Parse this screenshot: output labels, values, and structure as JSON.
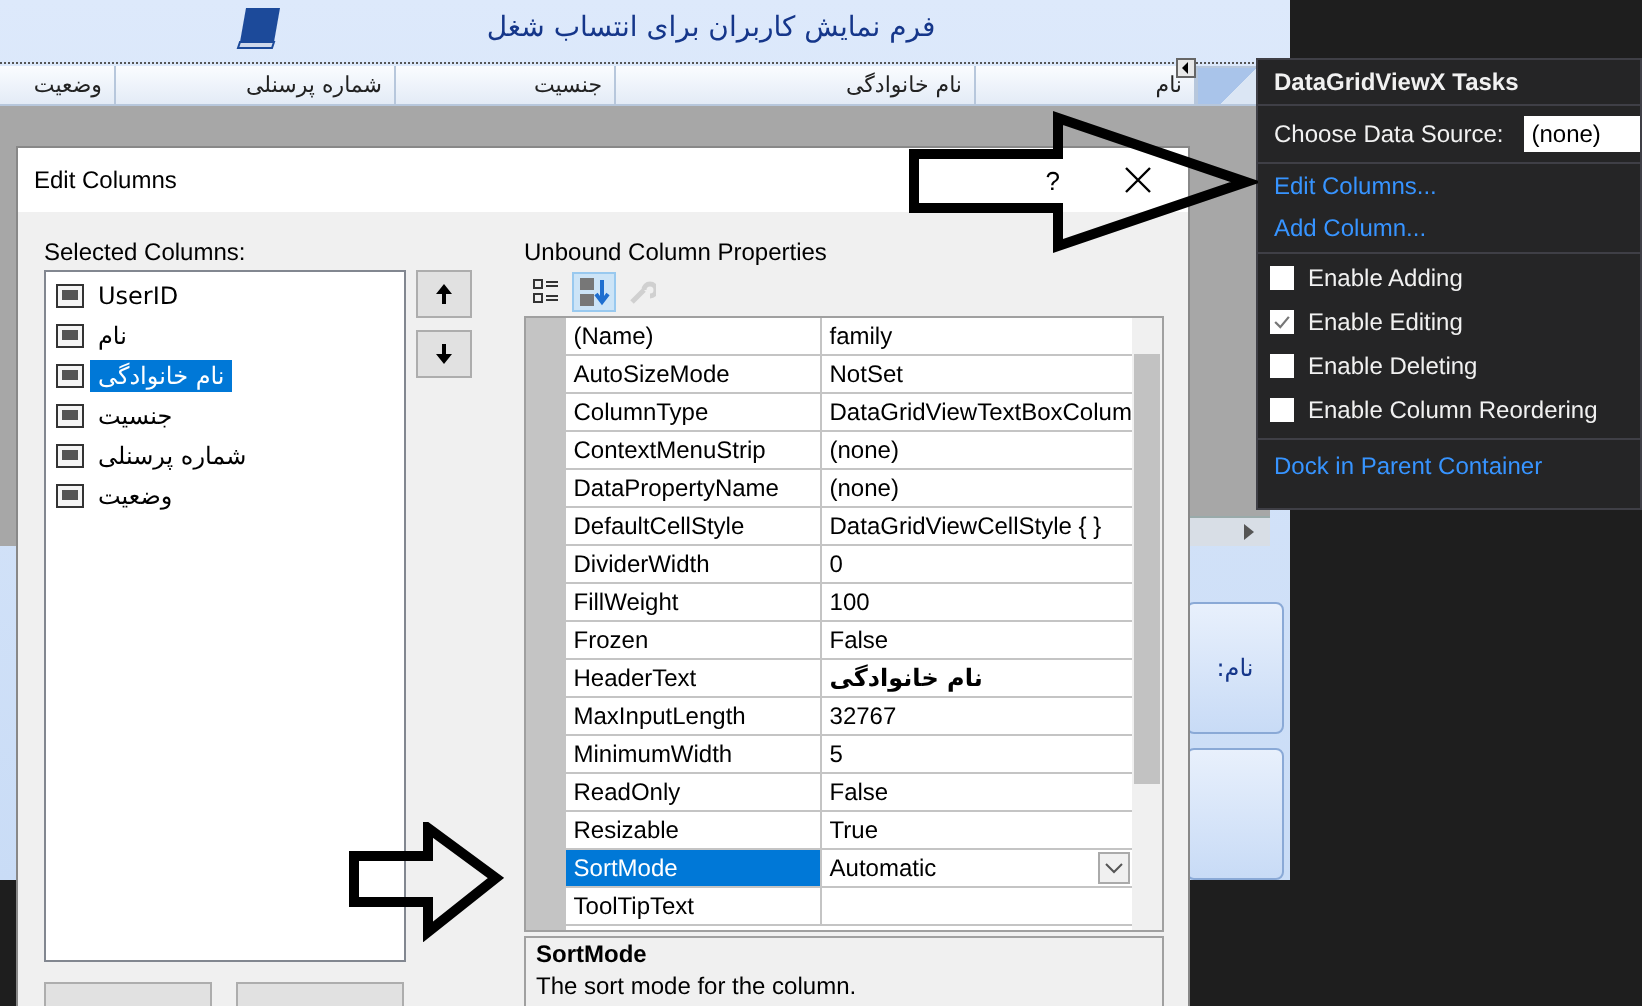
{
  "form": {
    "title": "فرم نمایش کاربران برای انتساب شغل",
    "grid_columns": [
      "نام",
      "نام خانوادگی",
      "جنسیت",
      "شماره پرسنلی",
      "وضعیت"
    ],
    "field_label": "نام:"
  },
  "dialog": {
    "title": "Edit Columns",
    "help": "?",
    "selected_columns_label": "Selected Columns:",
    "columns": [
      {
        "name": "UserID",
        "selected": false
      },
      {
        "name": "نام",
        "selected": false
      },
      {
        "name": "نام خانوادگی",
        "selected": true
      },
      {
        "name": "جنسیت",
        "selected": false
      },
      {
        "name": "شماره پرسنلی",
        "selected": false
      },
      {
        "name": "وضعیت",
        "selected": false
      }
    ],
    "properties_label": "Unbound Column Properties",
    "toolbar": [
      {
        "kind": "categorized",
        "selected": false,
        "disabled": false
      },
      {
        "kind": "alphabetical",
        "selected": true,
        "disabled": false
      },
      {
        "kind": "pages",
        "selected": false,
        "disabled": true
      }
    ],
    "properties": [
      {
        "name": "(Name)",
        "value": "family",
        "selected": false,
        "bold": false
      },
      {
        "name": "AutoSizeMode",
        "value": "NotSet",
        "selected": false,
        "bold": false
      },
      {
        "name": "ColumnType",
        "value": "DataGridViewTextBoxColum",
        "selected": false,
        "bold": false
      },
      {
        "name": "ContextMenuStrip",
        "value": "(none)",
        "selected": false,
        "bold": false
      },
      {
        "name": "DataPropertyName",
        "value": "(none)",
        "selected": false,
        "bold": false
      },
      {
        "name": "DefaultCellStyle",
        "value": "DataGridViewCellStyle { }",
        "selected": false,
        "bold": false
      },
      {
        "name": "DividerWidth",
        "value": "0",
        "selected": false,
        "bold": false
      },
      {
        "name": "FillWeight",
        "value": "100",
        "selected": false,
        "bold": false
      },
      {
        "name": "Frozen",
        "value": "False",
        "selected": false,
        "bold": false
      },
      {
        "name": "HeaderText",
        "value": "نام خانوادگی",
        "selected": false,
        "bold": true
      },
      {
        "name": "MaxInputLength",
        "value": "32767",
        "selected": false,
        "bold": false
      },
      {
        "name": "MinimumWidth",
        "value": "5",
        "selected": false,
        "bold": false
      },
      {
        "name": "ReadOnly",
        "value": "False",
        "selected": false,
        "bold": false
      },
      {
        "name": "Resizable",
        "value": "True",
        "selected": false,
        "bold": false
      },
      {
        "name": "SortMode",
        "value": "Automatic",
        "selected": true,
        "bold": false
      },
      {
        "name": "ToolTipText",
        "selected": false
      }
    ],
    "description": {
      "title": "SortMode",
      "text": "The sort mode for the column."
    }
  },
  "tasks": {
    "title": "DataGridViewX Tasks",
    "data_source_label": "Choose Data Source:",
    "data_source_value": "(none)",
    "items": [
      {
        "kind": "link",
        "label": "Edit Columns..."
      },
      {
        "kind": "link",
        "label": "Add Column..."
      },
      {
        "kind": "divider"
      },
      {
        "kind": "checkbox",
        "label": "Enable Adding",
        "checked": false
      },
      {
        "kind": "checkbox",
        "label": "Enable Editing",
        "checked": true
      },
      {
        "kind": "checkbox",
        "label": "Enable Deleting",
        "checked": false
      },
      {
        "kind": "checkbox",
        "label": "Enable Column Reordering",
        "checked": false
      },
      {
        "kind": "divider"
      },
      {
        "kind": "link",
        "label": "Dock in Parent Container"
      }
    ]
  }
}
